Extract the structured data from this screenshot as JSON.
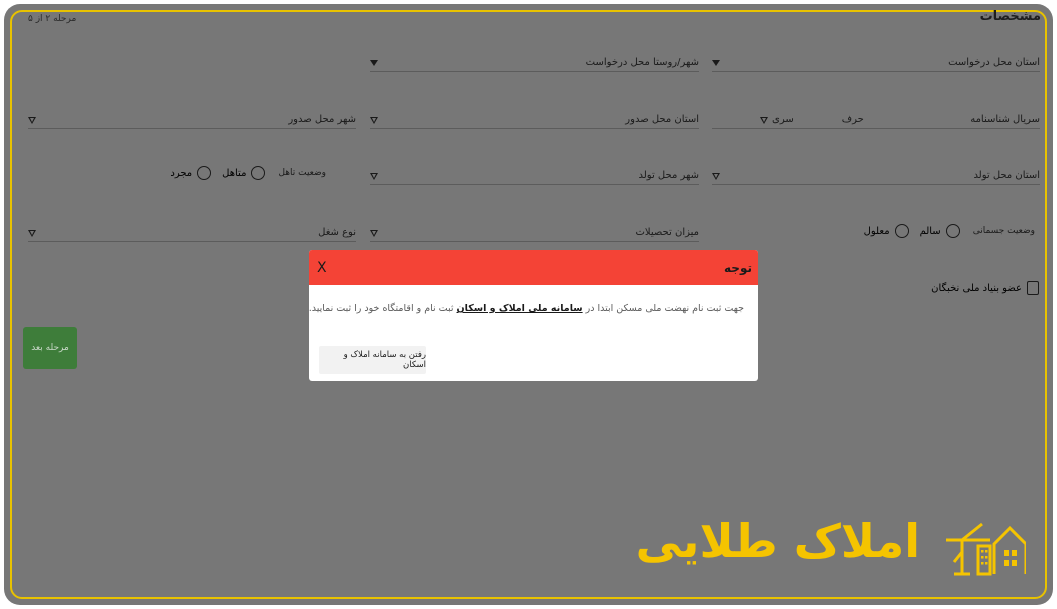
{
  "form": {
    "title": "مشخصات",
    "step": "مرحله ۲ از ۵",
    "fields": {
      "request_province": "استان محل درخواست",
      "request_city": "شهر/روستا محل درخواست",
      "id_serial": "سریال شناسنامه",
      "letter": "حرف",
      "series": "سری",
      "issue_province": "استان محل صدور",
      "issue_city": "شهر محل صدور",
      "birth_province": "استان محل تولد",
      "birth_city": "شهر محل تولد",
      "marital_label": "وضعیت تاهل",
      "married": "متاهل",
      "single": "مجرد",
      "physical_label": "وضعیت جسمانی",
      "healthy": "سالم",
      "disabled": "معلول",
      "education": "میزان تحصیلات",
      "job_type": "نوع شغل",
      "elite_member": "عضو بنیاد ملی نخبگان"
    },
    "next_button": "مرحله بعد"
  },
  "modal": {
    "title": "توجه",
    "close": "X",
    "message_before": "جهت ثبت نام نهضت ملی مسکن ابتدا در",
    "message_link": "سامانه ملی املاک و اسکان",
    "message_after": "ثبت نام و اقامتگاه خود را ثبت نمایید.",
    "button": "رفتن به سامانه املاک و اسکان"
  },
  "logo": {
    "text": "املاک طلایی",
    "icon": "house-crane-icon",
    "color": "#f5c400"
  },
  "colors": {
    "overlay": "#777777",
    "modal_header": "#f44336",
    "next_button": "#3e7d3a",
    "border": "#e8c200"
  }
}
